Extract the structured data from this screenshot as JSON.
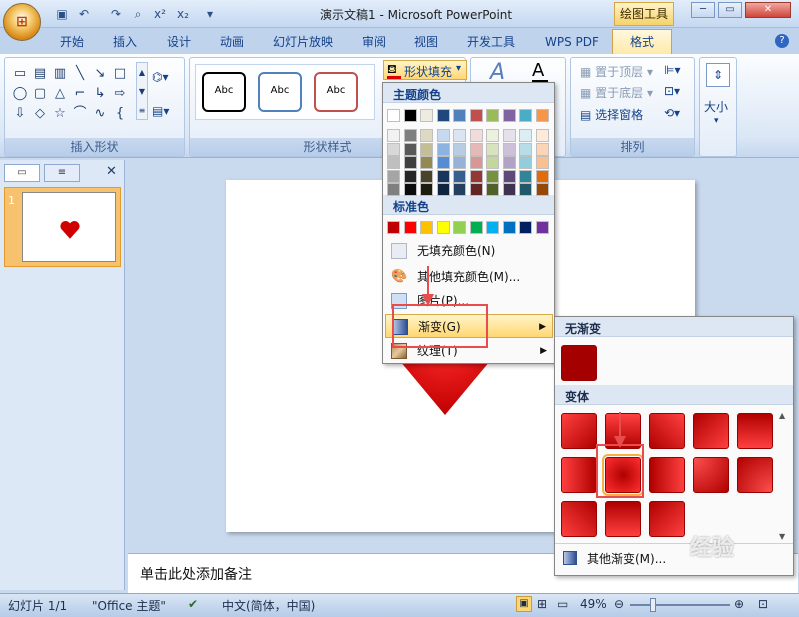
{
  "window": {
    "title": "演示文稿1 - Microsoft PowerPoint",
    "contextual_tab": "绘图工具",
    "minimize": "─",
    "restore": "▭",
    "close": "✕"
  },
  "tabs": [
    "开始",
    "插入",
    "设计",
    "动画",
    "幻灯片放映",
    "审阅",
    "视图",
    "开发工具",
    "WPS PDF",
    "格式"
  ],
  "ribbon": {
    "groups": {
      "insert_shapes": "插入形状",
      "shape_styles": "形状样式",
      "arrange": "排列"
    },
    "style_samples": [
      "Abc",
      "Abc",
      "Abc"
    ],
    "shape_fill_button": "形状填充",
    "bring_to_front": "置于顶层",
    "send_to_back": "置于底层",
    "selection_pane": "选择窗格",
    "size": "大小"
  },
  "color_menu": {
    "theme_colors_header": "主题颜色",
    "standard_colors_header": "标准色",
    "no_fill": "无填充颜色(N)",
    "more_colors": "其他填充颜色(M)...",
    "picture": "图片(P)...",
    "gradient": "渐变(G)",
    "texture": "纹理(T)",
    "theme_top": [
      "#ffffff",
      "#000000",
      "#eeece1",
      "#1f497d",
      "#4f81bd",
      "#c0504d",
      "#9bbb59",
      "#8064a2",
      "#4bacc6",
      "#f79646"
    ],
    "theme_shades": [
      [
        "#f2f2f2",
        "#7f7f7f",
        "#ddd9c3",
        "#c6d9f0",
        "#dbe5f1",
        "#f2dcdb",
        "#ebf1dd",
        "#e5e0ec",
        "#dbeef3",
        "#fdeada"
      ],
      [
        "#d8d8d8",
        "#595959",
        "#c4bd97",
        "#8db3e2",
        "#b8cce4",
        "#e5b9b7",
        "#d7e3bc",
        "#ccc1d9",
        "#b7dde8",
        "#fbd5b5"
      ],
      [
        "#bfbfbf",
        "#3f3f3f",
        "#938953",
        "#548dd4",
        "#95b3d7",
        "#d99694",
        "#c3d69b",
        "#b2a2c7",
        "#92cddc",
        "#fac08f"
      ],
      [
        "#a5a5a5",
        "#262626",
        "#494429",
        "#17365d",
        "#366092",
        "#953734",
        "#76923c",
        "#5f497a",
        "#31859b",
        "#e36c09"
      ],
      [
        "#7f7f7f",
        "#0c0c0c",
        "#1d1b10",
        "#0f243e",
        "#244061",
        "#632423",
        "#4f6128",
        "#3f3151",
        "#205867",
        "#974806"
      ]
    ],
    "standard": [
      "#c00000",
      "#ff0000",
      "#ffc000",
      "#ffff00",
      "#92d050",
      "#00b050",
      "#00b0f0",
      "#0070c0",
      "#002060",
      "#7030a0"
    ]
  },
  "gradient_menu": {
    "no_gradient_header": "无渐变",
    "variants_header": "变体",
    "more_gradients": "其他渐变(M)..."
  },
  "notes_placeholder": "单击此处添加备注",
  "status": {
    "slide": "幻灯片 1/1",
    "theme": "\"Office 主题\"",
    "language": "中文(简体，中国)",
    "zoom": "49%"
  },
  "thumbnail_number": "1",
  "watermark": "经验"
}
